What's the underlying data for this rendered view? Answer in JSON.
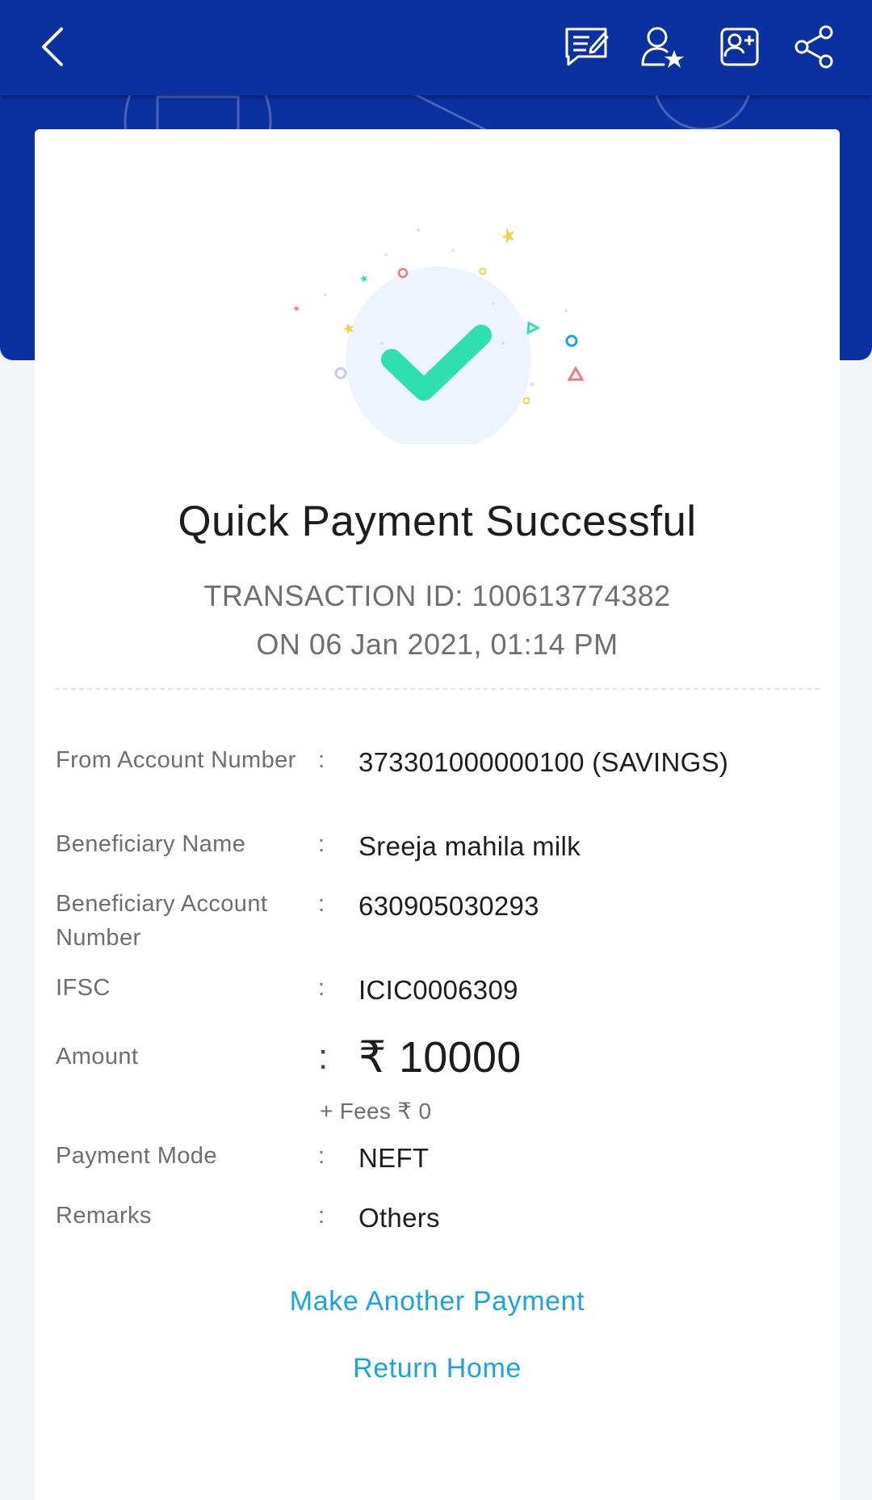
{
  "header": {
    "icons": [
      "back-arrow-icon",
      "feedback-icon",
      "favourite-payee-icon",
      "add-payee-icon",
      "share-icon"
    ]
  },
  "status": {
    "title": "Quick Payment Successful",
    "transaction_id": "TRANSACTION ID: 100613774382",
    "datetime": "ON 06 Jan 2021, 01:14 PM"
  },
  "details": [
    {
      "label": "From Account Number",
      "value": "373301000000100 (SAVINGS)"
    },
    {
      "label": "Beneficiary Name",
      "value": "Sreeja mahila milk"
    },
    {
      "label": "Beneficiary Account Number",
      "value": "630905030293"
    },
    {
      "label": "IFSC",
      "value": "ICIC0006309"
    },
    {
      "label": "Amount",
      "value": "₹ 10000",
      "fees": "+ Fees ₹ 0"
    },
    {
      "label": "Payment Mode",
      "value": "NEFT"
    },
    {
      "label": "Remarks",
      "value": "Others"
    }
  ],
  "colon": ":",
  "actions": {
    "another_payment": "Make Another Payment",
    "return_home": "Return Home"
  },
  "colors": {
    "header": "#0b30a0",
    "success": "#2ee0b0",
    "link": "#1aa3dc"
  }
}
